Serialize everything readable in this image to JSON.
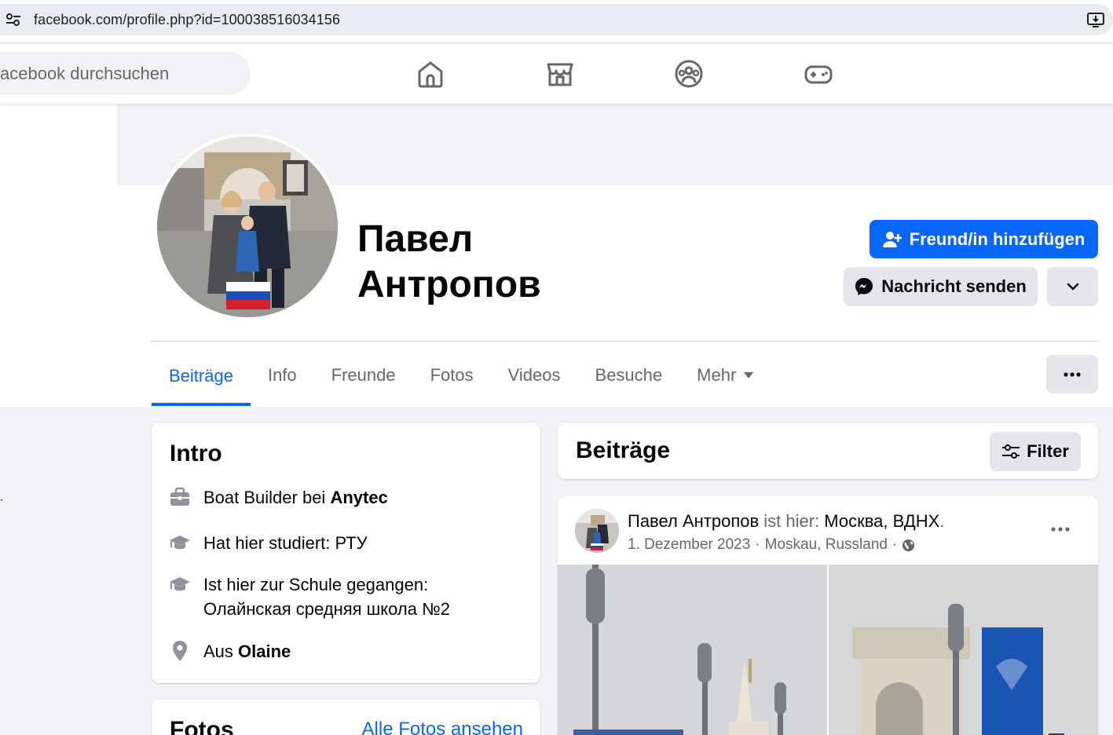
{
  "browser": {
    "url": "facebook.com/profile.php?id=100038516034156"
  },
  "header": {
    "search_placeholder": "acebook durchsuchen",
    "nav_icons": [
      "home-icon",
      "marketplace-icon",
      "groups-icon",
      "gaming-icon"
    ]
  },
  "profile": {
    "name_line1": "Павел",
    "name_line2": "Антропов",
    "add_friend_label": "Freund/in hinzufügen",
    "message_label": "Nachricht senden"
  },
  "tabs": [
    {
      "label": "Beiträge",
      "active": true
    },
    {
      "label": "Info"
    },
    {
      "label": "Freunde"
    },
    {
      "label": "Fotos"
    },
    {
      "label": "Videos"
    },
    {
      "label": "Besuche"
    },
    {
      "label": "Mehr"
    }
  ],
  "intro": {
    "title": "Intro",
    "work_prefix": "Boat Builder bei ",
    "work_company": "Anytec",
    "studied": "Hat hier studiert: РТУ",
    "school_line1": "Ist hier zur Schule gegangen:",
    "school_line2": "Олайнская средняя школа №2",
    "from_prefix": "Aus ",
    "from_place": "Olaine"
  },
  "fotos": {
    "title": "Fotos",
    "link": "Alle Fotos ansehen"
  },
  "posts": {
    "title": "Beiträge",
    "filter_label": "Filter",
    "items": [
      {
        "author": "Павел Антропов",
        "action": " ist hier: ",
        "place": "Москва, ВДНХ",
        "place_suffix": ".",
        "date": "1. Dezember 2023",
        "sep1": "·",
        "location": "Moskau, Russland",
        "sep2": "·"
      }
    ]
  },
  "colors": {
    "accent": "#0866ff",
    "muted_text": "#65676b",
    "button_gray": "#e4e6eb",
    "page_bg": "#f0f2f5"
  }
}
